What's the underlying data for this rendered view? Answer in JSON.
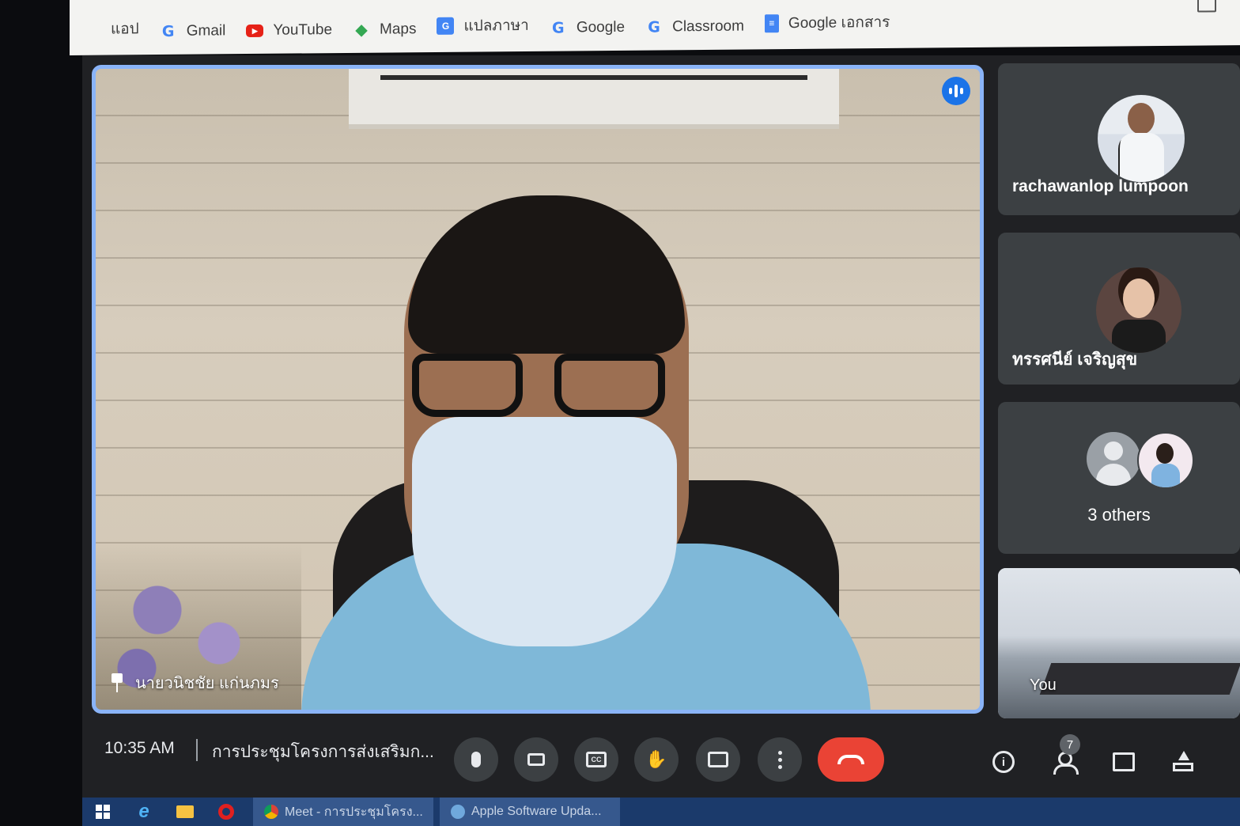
{
  "bookmarks": [
    {
      "label": "แอป",
      "icon": "apps-grid-icon"
    },
    {
      "label": "Gmail",
      "icon": "google-g-icon"
    },
    {
      "label": "YouTube",
      "icon": "youtube-icon"
    },
    {
      "label": "Maps",
      "icon": "maps-icon"
    },
    {
      "label": "แปลภาษา",
      "icon": "translate-icon"
    },
    {
      "label": "Google",
      "icon": "google-g-icon"
    },
    {
      "label": "Classroom",
      "icon": "google-g-icon"
    },
    {
      "label": "Google เอกสาร",
      "icon": "docs-icon"
    }
  ],
  "main_tile": {
    "participant_name": "นายวนิชชัย แก่นภมร",
    "speaking": true
  },
  "side_tiles": [
    {
      "name": "rachawanlop lumpoon"
    },
    {
      "name": "ทรรศนีย์ เจริญสุข"
    },
    {
      "name": "3 others"
    },
    {
      "name": "You"
    }
  ],
  "bottom_bar": {
    "time": "10:35 AM",
    "meeting_title": "การประชุมโครงการส่งเสริมก...",
    "participant_count": "7"
  },
  "taskbar": {
    "items": [
      {
        "label": "Meet - การประชุมโครง..."
      },
      {
        "label": "Apple Software Upda..."
      }
    ]
  },
  "colors": {
    "meet_background": "#202124",
    "active_speaker_border": "#8ab4f8",
    "end_call": "#ea4335",
    "control_button": "#3c4043",
    "taskbar": "#1b3a6b"
  }
}
